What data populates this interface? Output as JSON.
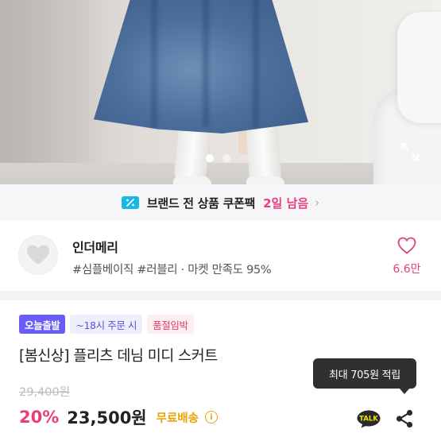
{
  "photo": {
    "alt": "product photo",
    "page_indicator": {
      "total": 2,
      "active": 1
    }
  },
  "icons": {
    "expand": "expand-icon",
    "coupon": "coupon-icon",
    "chevron": "chevron-right-icon",
    "heart": "heart-outline-icon",
    "talk": "kakao-talk-icon",
    "share": "share-icon",
    "info": "info-icon"
  },
  "coupon_bar": {
    "text": "브랜드 전 상품 쿠폰팩",
    "time_left": "2일 남음",
    "chevron": "›"
  },
  "shop": {
    "name": "인더메리",
    "tags": "#심플베이직 #러블리 · 마켓 만족도 95%",
    "like_count": "6.6만"
  },
  "product": {
    "badges": [
      {
        "label": "오늘출발"
      },
      {
        "label": "~18시 주문 시"
      },
      {
        "label": "품절임박"
      }
    ],
    "title": "[봄신상] 플리츠 데님 미디 스커트",
    "original_price": "29,400원",
    "discount": "20%",
    "price": "23,500원",
    "shipping": "무료배송",
    "info_glyph": "i"
  },
  "tooltip": {
    "text": "최대 705원 적립"
  },
  "talk_label": "TALK",
  "colors": {
    "accent_pink": "#ea3d7d",
    "badge_purple": "#6a5cf6",
    "shipping_yellow": "#e9a400",
    "coupon_blue": "#19b6e8"
  }
}
